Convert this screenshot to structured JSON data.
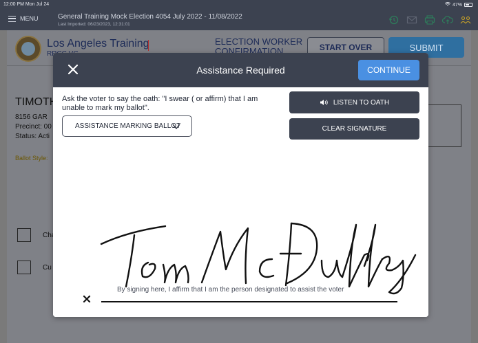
{
  "status_bar": {
    "time_date": "12:00 PM  Mon Jul 24",
    "battery": "47%"
  },
  "top_bar": {
    "menu_label": "MENU",
    "title": "General Training Mock Election 4054  July 2022  - 11/08/2022",
    "last_imported": "Last Imported: 06/23/2023, 12:31:01",
    "icons": [
      "history-icon",
      "mail-icon",
      "printer-icon",
      "cloud-upload-icon",
      "users-icon"
    ]
  },
  "page": {
    "org_name": "Los Angeles Training",
    "org_sub": "RRCC VC",
    "title": "ELECTION WORKER CONFIRMATION",
    "start_over_label": "START OVER",
    "submit_label": "SUBMIT",
    "voter_name": "TIMOTH",
    "voter_address": "8156 GAR",
    "voter_precinct": "Precinct: 00",
    "voter_status": "Status: Acti",
    "ballot_style": "Ballot Style:",
    "checkbox_labels": [
      "Cha",
      "Cu"
    ]
  },
  "modal": {
    "title": "Assistance Required",
    "continue_label": "CONTINUE",
    "instruction": "Ask the voter to say the oath: \"I swear ( or affirm) that I am unable to mark my ballot\".",
    "select_value": "ASSISTANCE MARKING BALLOT",
    "listen_label": "LISTEN TO OATH",
    "clear_label": "CLEAR SIGNATURE",
    "affirm_text": "By signing here, I affirm that I am the person designated to assist the voter"
  },
  "colors": {
    "header_bg": "#3c4250",
    "accent_blue": "#4a90e2",
    "page_overlay": "#7f8187",
    "modal_button": "#3c4250"
  }
}
